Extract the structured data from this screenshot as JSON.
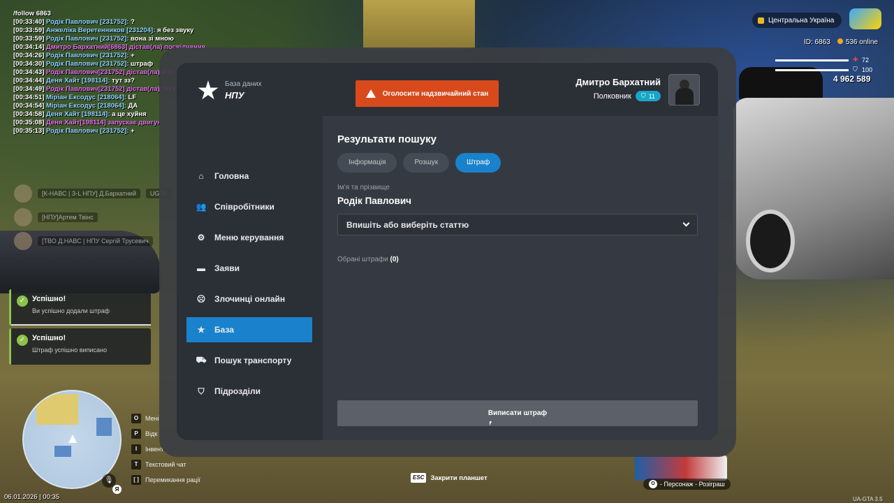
{
  "chat": [
    {
      "time": "",
      "name": "/follow 6863",
      "text": "",
      "color": "white"
    },
    {
      "time": "[00:33:40]",
      "name": "Родік Павлович [231752]:",
      "text": " ?",
      "color": "blue"
    },
    {
      "time": "[00:33:59]",
      "name": "Анжеліка Веретенников [231204]:",
      "text": " я без звуку",
      "color": "blue"
    },
    {
      "time": "[00:33:59]",
      "name": "Родік Павлович [231752]:",
      "text": " вона зі мною",
      "color": "blue"
    },
    {
      "time": "[00:34:14]",
      "name": "Дмитро Бархатний[6863] дістав(ла) посвідчення",
      "text": "",
      "color": "pink"
    },
    {
      "time": "[00:34:26]",
      "name": "Родік Павлович [231752]:",
      "text": " +",
      "color": "blue"
    },
    {
      "time": "[00:34:30]",
      "name": "Родік Павлович [231752]:",
      "text": " штраф",
      "color": "blue"
    },
    {
      "time": "[00:34:43]",
      "name": "Родік Павлович[231752] дістав(ла) вод.посвідчення",
      "text": "",
      "color": "pink"
    },
    {
      "time": "[00:34:44]",
      "name": "Деня Хайт [198114]:",
      "text": " тут зз?",
      "color": "blue"
    },
    {
      "time": "[00:34:49]",
      "name": "Родік Павлович[231752] дістав(ла) тех.паспорт",
      "text": "",
      "color": "pink"
    },
    {
      "time": "[00:34:51]",
      "name": "Міріан Ексодус [218064]:",
      "text": " LF",
      "color": "blue"
    },
    {
      "time": "[00:34:54]",
      "name": "Міріан Ексодус [218064]:",
      "text": " ДА",
      "color": "blue"
    },
    {
      "time": "[00:34:58]",
      "name": "Деня Хайт [198114]:",
      "text": " а це хуйня",
      "color": "blue"
    },
    {
      "time": "[00:35:08]",
      "name": "Деня Хайт[198114] запускає двигун",
      "text": "",
      "color": "pink"
    },
    {
      "time": "[00:35:13]",
      "name": "Родік Павлович [231752]:",
      "text": " +",
      "color": "blue"
    }
  ],
  "players": [
    {
      "tag": "[К-НАВС | З-L НПУ] Д.Бархатний",
      "extra": "UGTA"
    },
    {
      "tag": "[НПУ]Артем Твінс",
      "extra": ""
    },
    {
      "tag": "[ТВО Д.НАВС | НПУ Сергій Трусевич",
      "extra": ""
    }
  ],
  "toasts": [
    {
      "title": "Успішно!",
      "text": "Ви успішно додали штраф"
    },
    {
      "title": "Успішно!",
      "text": "Штраф успішно виписано"
    }
  ],
  "hud": {
    "region": "Центральна Україна",
    "id_label": "ID: 6863",
    "online": "536 online",
    "health": "72",
    "armor": "100",
    "money": "4 962 589",
    "date_time": "06.01.2026 | 00:35",
    "version": "UA-GTA 3.5",
    "giveaway_caption": "- Персонаж - Розіграш",
    "giveaway_key": "O",
    "mic_key": "Я"
  },
  "keybinds": [
    {
      "key": "O",
      "label": "Мені"
    },
    {
      "key": "P",
      "label": "Відк"
    },
    {
      "key": "I",
      "label": "Інвент"
    },
    {
      "key": "T",
      "label": "Текстовий чат"
    },
    {
      "key": "[  ]",
      "label": "Перемикання рації"
    }
  ],
  "esc": {
    "key": "ESC",
    "label": "Закрити планшет"
  },
  "tablet": {
    "db_label": "База даних",
    "org": "НПУ",
    "emergency_label": "Оголосити надзвичайний стан",
    "user_name": "Дмитро Бархатний",
    "user_rank": "Полковник",
    "rank_level": "11",
    "nav": [
      {
        "label": "Головна",
        "icon": "home-icon"
      },
      {
        "label": "Співробітники",
        "icon": "users-icon"
      },
      {
        "label": "Меню керування",
        "icon": "gear-icon"
      },
      {
        "label": "Заяви",
        "icon": "folder-icon"
      },
      {
        "label": "Злочинці онлайн",
        "icon": "mask-icon"
      },
      {
        "label": "База",
        "icon": "star-icon"
      },
      {
        "label": "Пошук транспорту",
        "icon": "car-icon"
      },
      {
        "label": "Підрозділи",
        "icon": "shield-icon"
      }
    ],
    "active_nav": "База",
    "results_title": "Результати пошуку",
    "tabs": [
      "Інформація",
      "Розшук",
      "Штраф"
    ],
    "active_tab": "Штраф",
    "field_label": "Ім'я та прізвище",
    "field_value": "Родік Павлович",
    "select_placeholder": "Впишіть або виберіть статтю",
    "selected_label": "Обрані штрафи",
    "selected_count": "(0)",
    "issue_button": "Виписати штраф"
  },
  "colors": {
    "accent": "#1a82cc",
    "emergency": "#d84a1c",
    "success": "#8bc34a",
    "rank_badge": "#17a6c9"
  }
}
